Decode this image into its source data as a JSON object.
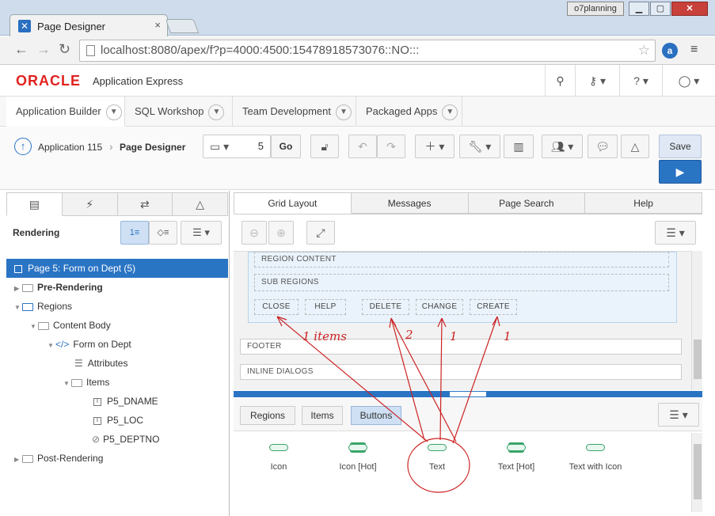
{
  "browser": {
    "tab_title": "Page Designer",
    "tab_close": "×",
    "user_chip": "o7planning",
    "url": "localhost:8080/apex/f?p=4000:4500:15478918573076::NO:::",
    "win_min": "▁",
    "win_max": "▢",
    "win_close": "✕",
    "ext_label": "a"
  },
  "apex": {
    "logo": "ORACLE",
    "logo_sub": "Application Express"
  },
  "nav_tabs": [
    {
      "label": "Application Builder"
    },
    {
      "label": "SQL Workshop"
    },
    {
      "label": "Team Development"
    },
    {
      "label": "Packaged Apps"
    }
  ],
  "toolbar": {
    "app_label": "Application 115",
    "crumb_sep": "›",
    "page_designer": "Page Designer",
    "page_number": "5",
    "go_label": "Go",
    "save_label": "Save"
  },
  "left": {
    "rendering_label": "Rendering",
    "tree": [
      {
        "label": "Page 5: Form on Dept (5)"
      },
      {
        "label": "Pre-Rendering"
      },
      {
        "label": "Regions"
      },
      {
        "label": "Content Body"
      },
      {
        "label": "Form on Dept"
      },
      {
        "label": "Attributes"
      },
      {
        "label": "Items"
      },
      {
        "label": "P5_DNAME"
      },
      {
        "label": "P5_LOC"
      },
      {
        "label": "P5_DEPTNO"
      },
      {
        "label": "Post-Rendering"
      }
    ]
  },
  "right": {
    "tabs": [
      "Grid Layout",
      "Messages",
      "Page Search",
      "Help"
    ],
    "region_content": "REGION CONTENT",
    "sub_regions": "SUB REGIONS",
    "buttons": [
      "CLOSE",
      "HELP",
      "DELETE",
      "CHANGE",
      "CREATE"
    ],
    "footer": "FOOTER",
    "inline_dialogs": "INLINE DIALOGS",
    "gallery_tabs": [
      "Regions",
      "Items",
      "Buttons"
    ],
    "gallery_items": [
      "Icon",
      "Icon [Hot]",
      "Text",
      "Text [Hot]",
      "Text with Icon"
    ]
  },
  "annotations": {
    "close_count": "1 items",
    "delete_count": "2",
    "change_count": "1",
    "create_count": "1",
    "stroke_color": "#cc2222"
  }
}
